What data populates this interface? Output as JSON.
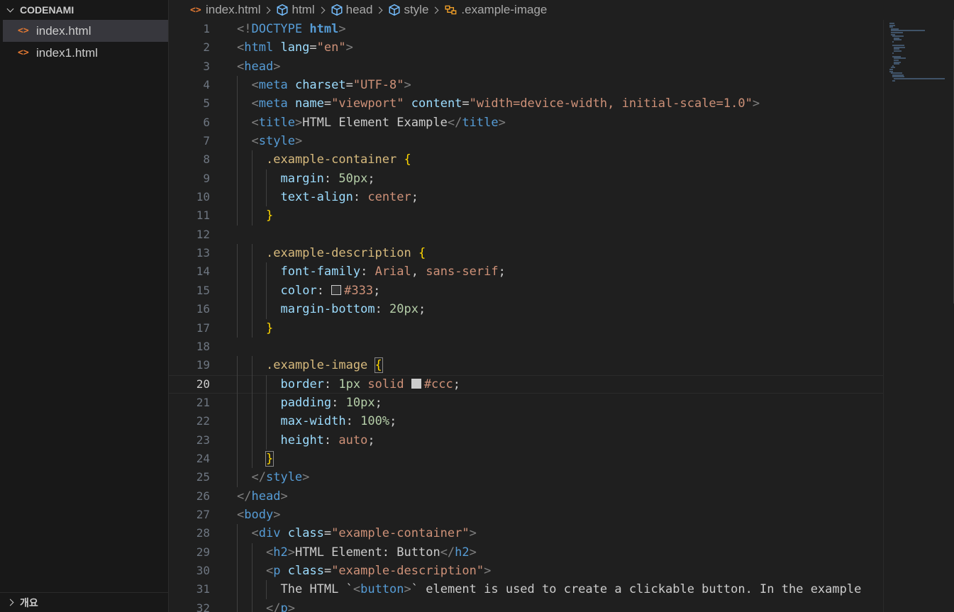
{
  "sidebar": {
    "folder_name": "CODENAMI",
    "files": [
      {
        "name": "index.html",
        "active": true
      },
      {
        "name": "index1.html",
        "active": false
      }
    ],
    "outline_label": "개요"
  },
  "breadcrumb": [
    "index.html",
    "html",
    "head",
    "style",
    ".example-image"
  ],
  "editor": {
    "current_line": 20,
    "lines": [
      {
        "n": "1",
        "indent": 0
      },
      {
        "n": "2",
        "indent": 0
      },
      {
        "n": "3",
        "indent": 0
      },
      {
        "n": "4",
        "indent": 1
      },
      {
        "n": "5",
        "indent": 1
      },
      {
        "n": "6",
        "indent": 1
      },
      {
        "n": "7",
        "indent": 1
      },
      {
        "n": "8",
        "indent": 2
      },
      {
        "n": "9",
        "indent": 3
      },
      {
        "n": "10",
        "indent": 3
      },
      {
        "n": "11",
        "indent": 2
      },
      {
        "n": "12",
        "indent": 0
      },
      {
        "n": "13",
        "indent": 2
      },
      {
        "n": "14",
        "indent": 3
      },
      {
        "n": "15",
        "indent": 3
      },
      {
        "n": "16",
        "indent": 3
      },
      {
        "n": "17",
        "indent": 2
      },
      {
        "n": "18",
        "indent": 0
      },
      {
        "n": "19",
        "indent": 2
      },
      {
        "n": "20",
        "indent": 3
      },
      {
        "n": "21",
        "indent": 3
      },
      {
        "n": "22",
        "indent": 3
      },
      {
        "n": "23",
        "indent": 3
      },
      {
        "n": "24",
        "indent": 2
      },
      {
        "n": "25",
        "indent": 1
      },
      {
        "n": "26",
        "indent": 0
      },
      {
        "n": "27",
        "indent": 0
      },
      {
        "n": "28",
        "indent": 1
      },
      {
        "n": "29",
        "indent": 2
      },
      {
        "n": "30",
        "indent": 2
      },
      {
        "n": "31",
        "indent": 3
      },
      {
        "n": "32",
        "indent": 2
      }
    ],
    "tokens": [
      [
        [
          "t-br",
          "<!"
        ],
        [
          "t-tag",
          "DOCTYPE"
        ],
        [
          "t-txt",
          " "
        ],
        [
          "t-kw",
          "html"
        ],
        [
          "t-br",
          ">"
        ]
      ],
      [
        [
          "t-br",
          "<"
        ],
        [
          "t-tag",
          "html"
        ],
        [
          "t-txt",
          " "
        ],
        [
          "t-attr",
          "lang"
        ],
        [
          "t-txt",
          "="
        ],
        [
          "t-str",
          "\"en\""
        ],
        [
          "t-br",
          ">"
        ]
      ],
      [
        [
          "t-br",
          "<"
        ],
        [
          "t-tag",
          "head"
        ],
        [
          "t-br",
          ">"
        ]
      ],
      [
        [
          "t-br",
          "<"
        ],
        [
          "t-tag",
          "meta"
        ],
        [
          "t-txt",
          " "
        ],
        [
          "t-attr",
          "charset"
        ],
        [
          "t-txt",
          "="
        ],
        [
          "t-str",
          "\"UTF-8\""
        ],
        [
          "t-br",
          ">"
        ]
      ],
      [
        [
          "t-br",
          "<"
        ],
        [
          "t-tag",
          "meta"
        ],
        [
          "t-txt",
          " "
        ],
        [
          "t-attr",
          "name"
        ],
        [
          "t-txt",
          "="
        ],
        [
          "t-str",
          "\"viewport\""
        ],
        [
          "t-txt",
          " "
        ],
        [
          "t-attr",
          "content"
        ],
        [
          "t-txt",
          "="
        ],
        [
          "t-str",
          "\"width=device-width, initial-scale=1.0\""
        ],
        [
          "t-br",
          ">"
        ]
      ],
      [
        [
          "t-br",
          "<"
        ],
        [
          "t-tag",
          "title"
        ],
        [
          "t-br",
          ">"
        ],
        [
          "t-txt",
          "HTML Element Example"
        ],
        [
          "t-br",
          "</"
        ],
        [
          "t-tag",
          "title"
        ],
        [
          "t-br",
          ">"
        ]
      ],
      [
        [
          "t-br",
          "<"
        ],
        [
          "t-tag",
          "style"
        ],
        [
          "t-br",
          ">"
        ]
      ],
      [
        [
          "t-sel",
          ".example-container"
        ],
        [
          "t-txt",
          " "
        ],
        [
          "t-brace",
          "{"
        ]
      ],
      [
        [
          "t-prop",
          "margin"
        ],
        [
          "t-txt",
          ": "
        ],
        [
          "t-num",
          "50px"
        ],
        [
          "t-txt",
          ";"
        ]
      ],
      [
        [
          "t-prop",
          "text-align"
        ],
        [
          "t-txt",
          ": "
        ],
        [
          "t-str",
          "center"
        ],
        [
          "t-txt",
          ";"
        ]
      ],
      [
        [
          "t-brace",
          "}"
        ]
      ],
      [],
      [
        [
          "t-sel",
          ".example-description"
        ],
        [
          "t-txt",
          " "
        ],
        [
          "t-brace",
          "{"
        ]
      ],
      [
        [
          "t-prop",
          "font-family"
        ],
        [
          "t-txt",
          ": "
        ],
        [
          "t-str",
          "Arial"
        ],
        [
          "t-txt",
          ", "
        ],
        [
          "t-str",
          "sans-serif"
        ],
        [
          "t-txt",
          ";"
        ]
      ],
      [
        [
          "t-prop",
          "color"
        ],
        [
          "t-txt",
          ": "
        ],
        [
          "swatch",
          "#333333"
        ],
        [
          "t-str",
          "#333"
        ],
        [
          "t-txt",
          ";"
        ]
      ],
      [
        [
          "t-prop",
          "margin-bottom"
        ],
        [
          "t-txt",
          ": "
        ],
        [
          "t-num",
          "20px"
        ],
        [
          "t-txt",
          ";"
        ]
      ],
      [
        [
          "t-brace",
          "}"
        ]
      ],
      [],
      [
        [
          "t-sel",
          ".example-image"
        ],
        [
          "t-txt",
          " "
        ],
        [
          "t-brace brace-match",
          "{"
        ]
      ],
      [
        [
          "t-prop",
          "border"
        ],
        [
          "t-txt",
          ": "
        ],
        [
          "t-num",
          "1px"
        ],
        [
          "t-txt",
          " "
        ],
        [
          "t-str",
          "solid"
        ],
        [
          "t-txt",
          " "
        ],
        [
          "swatch",
          "#cccccc"
        ],
        [
          "t-str",
          "#ccc"
        ],
        [
          "t-txt",
          ";"
        ]
      ],
      [
        [
          "t-prop",
          "padding"
        ],
        [
          "t-txt",
          ": "
        ],
        [
          "t-num",
          "10px"
        ],
        [
          "t-txt",
          ";"
        ]
      ],
      [
        [
          "t-prop",
          "max-width"
        ],
        [
          "t-txt",
          ": "
        ],
        [
          "t-num",
          "100%"
        ],
        [
          "t-txt",
          ";"
        ]
      ],
      [
        [
          "t-prop",
          "height"
        ],
        [
          "t-txt",
          ": "
        ],
        [
          "t-str",
          "auto"
        ],
        [
          "t-txt",
          ";"
        ]
      ],
      [
        [
          "t-brace brace-match",
          "}"
        ]
      ],
      [
        [
          "t-br",
          "</"
        ],
        [
          "t-tag",
          "style"
        ],
        [
          "t-br",
          ">"
        ]
      ],
      [
        [
          "t-br",
          "</"
        ],
        [
          "t-tag",
          "head"
        ],
        [
          "t-br",
          ">"
        ]
      ],
      [
        [
          "t-br",
          "<"
        ],
        [
          "t-tag",
          "body"
        ],
        [
          "t-br",
          ">"
        ]
      ],
      [
        [
          "t-br",
          "<"
        ],
        [
          "t-tag",
          "div"
        ],
        [
          "t-txt",
          " "
        ],
        [
          "t-attr",
          "class"
        ],
        [
          "t-txt",
          "="
        ],
        [
          "t-str",
          "\"example-container\""
        ],
        [
          "t-br",
          ">"
        ]
      ],
      [
        [
          "t-br",
          "<"
        ],
        [
          "t-tag",
          "h2"
        ],
        [
          "t-br",
          ">"
        ],
        [
          "t-txt",
          "HTML Element: Button"
        ],
        [
          "t-br",
          "</"
        ],
        [
          "t-tag",
          "h2"
        ],
        [
          "t-br",
          ">"
        ]
      ],
      [
        [
          "t-br",
          "<"
        ],
        [
          "t-tag",
          "p"
        ],
        [
          "t-txt",
          " "
        ],
        [
          "t-attr",
          "class"
        ],
        [
          "t-txt",
          "="
        ],
        [
          "t-str",
          "\"example-description\""
        ],
        [
          "t-br",
          ">"
        ]
      ],
      [
        [
          "t-txt",
          "The HTML `"
        ],
        [
          "t-br",
          "<"
        ],
        [
          "t-tag",
          "button"
        ],
        [
          "t-br",
          ">"
        ],
        [
          "t-txt",
          "` element is used to create a clickable button. In the example"
        ]
      ],
      [
        [
          "t-br",
          "</"
        ],
        [
          "t-tag",
          "p"
        ],
        [
          "t-br",
          ">"
        ]
      ]
    ]
  }
}
